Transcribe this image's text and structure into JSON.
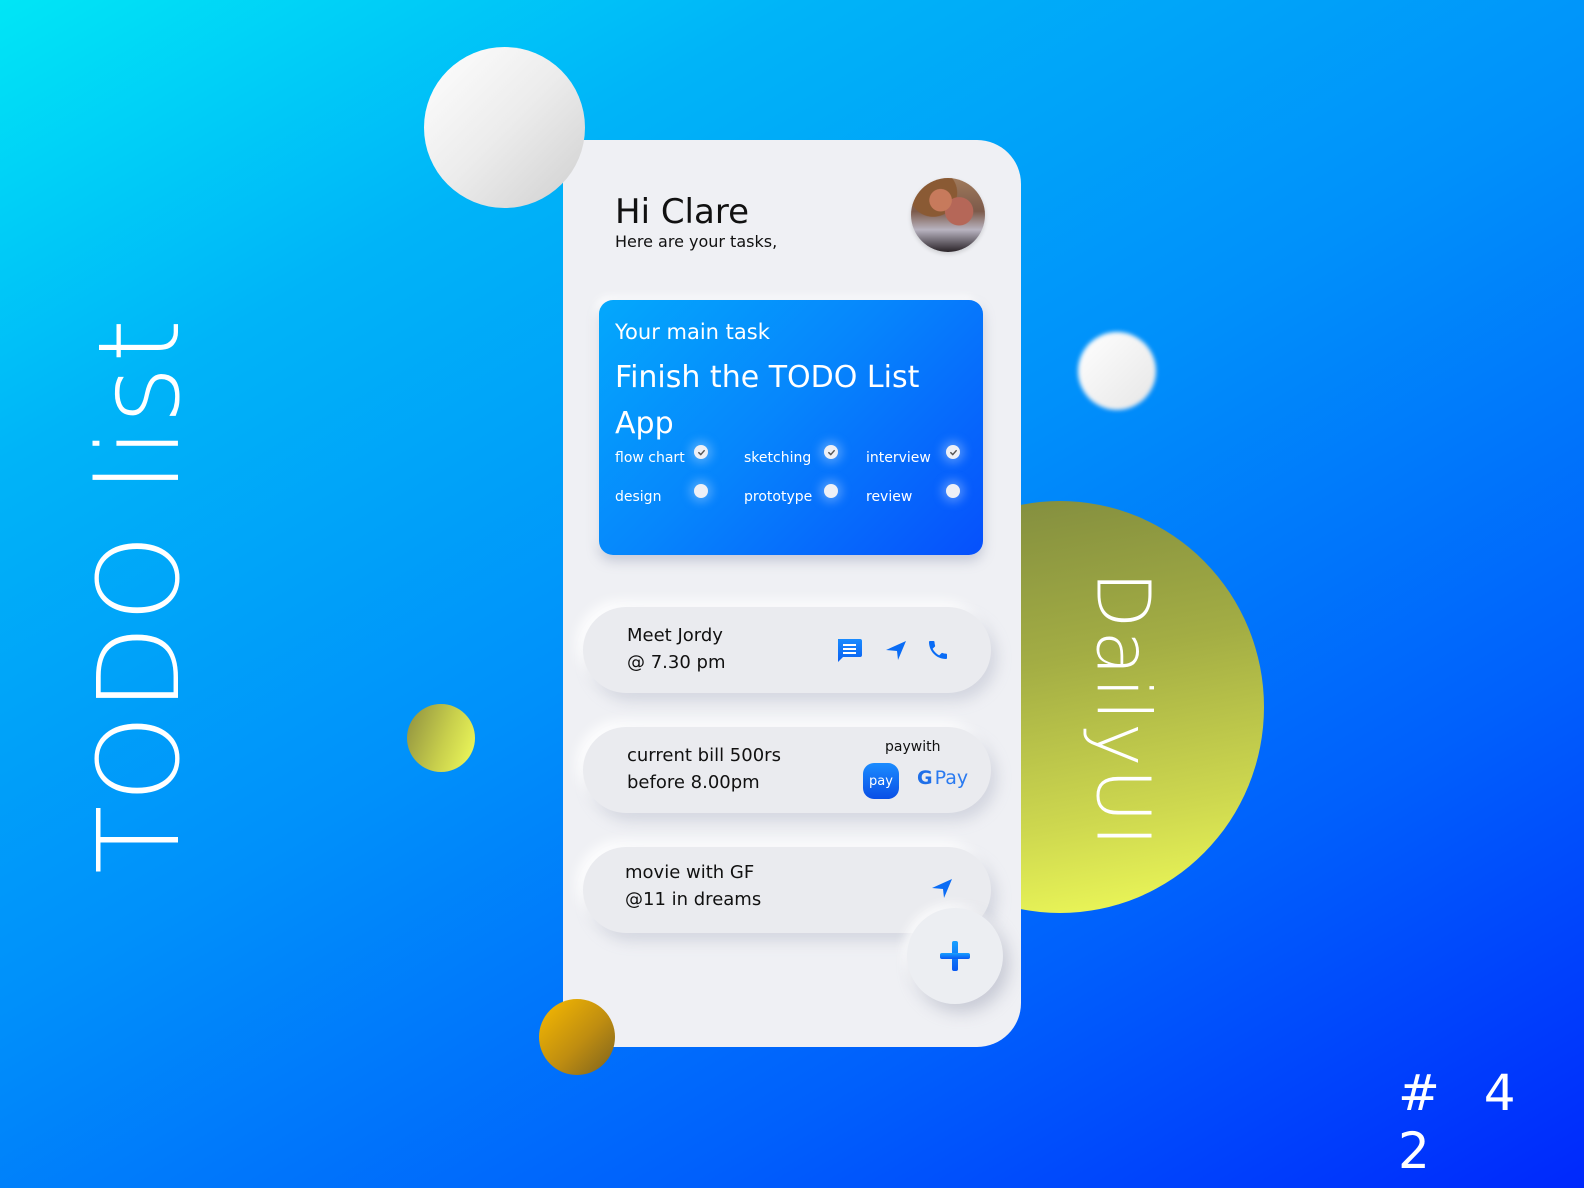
{
  "poster": {
    "side_title": "TODO list",
    "brand_label": "DailyUI",
    "challenge_number": "# 4 2"
  },
  "header": {
    "greeting": "Hi Clare",
    "subtitle": "Here are your tasks,",
    "avatar_icon": "user-avatar"
  },
  "main_task": {
    "eyebrow": "Your main task",
    "title": "Finish the TODO List App",
    "subtasks": [
      {
        "label": "flow chart",
        "done": true
      },
      {
        "label": "sketching",
        "done": true
      },
      {
        "label": "interview",
        "done": true
      },
      {
        "label": "design",
        "done": false
      },
      {
        "label": "prototype",
        "done": false
      },
      {
        "label": "review",
        "done": false
      }
    ]
  },
  "tasks": [
    {
      "line1": "Meet Jordy",
      "line2": "@ 7.30 pm",
      "icons": [
        "message-icon",
        "navigation-icon",
        "phone-icon"
      ]
    },
    {
      "line1": "current bill 500rs",
      "line2": "before 8.00pm",
      "paywith_label": "paywith",
      "samsung_pay_label": "pay",
      "gpay_g": "G",
      "gpay_label": "Pay"
    },
    {
      "line1": "movie with GF",
      "line2": "@11 in dreams",
      "icons": [
        "navigation-icon"
      ]
    }
  ],
  "fab": {
    "icon": "plus-icon"
  },
  "colors": {
    "accent_blue": "#0a6cf5",
    "card_bg": "#eff0f4",
    "lime": "#f1fd5c",
    "gold": "#f9bb00"
  }
}
